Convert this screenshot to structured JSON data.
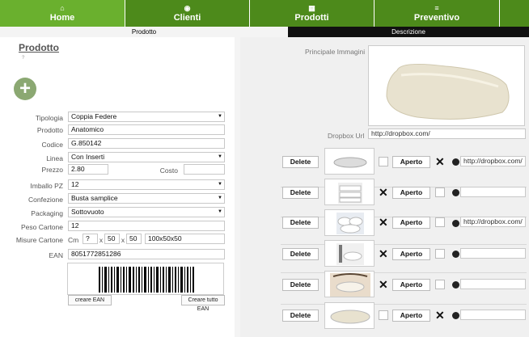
{
  "nav": {
    "home": "Home",
    "clienti": "Clienti",
    "prodotti": "Prodotti",
    "preventivo": "Preventivo"
  },
  "subtabs": {
    "prodotto": "Prodotto",
    "descrizione": "Descrizione"
  },
  "form": {
    "title": "Prodotto",
    "tiny": "?",
    "tipologia_label": "Tipologia",
    "tipologia_value": "Coppia Federe",
    "prodotto_label": "Prodotto",
    "prodotto_value": "Anatomico",
    "codice_label": "Codice",
    "codice_value": "G.850142",
    "linea_label": "Linea",
    "linea_value": "Con Inserti",
    "prezzo_label": "Prezzo",
    "prezzo_value": "2.80",
    "costo_label": "Costo",
    "costo_value": "",
    "imballo_label": "Imballo PZ",
    "imballo_value": "12",
    "confezione_label": "Confezione",
    "confezione_value": "Busta samplice",
    "packaging_label": "Packaging",
    "packaging_value": "Sottovuoto",
    "peso_label": "Peso Cartone",
    "peso_value": "12",
    "misure_label": "Misure Cartone",
    "misure_unit": "Cm",
    "misure_a": "?",
    "misure_b": "50",
    "misure_c": "50",
    "misure_sep1": "x",
    "misure_sep2": "x",
    "misure_total": "100x50x50",
    "ean_label": "EAN",
    "ean_value": "8051772851286",
    "crea_ean": "creare EAN",
    "crea_tutto": "Creare tutto EAN"
  },
  "images": {
    "principale_label": "Principale Immagini",
    "dropbox_label": "Dropbox Url",
    "dropbox_value": "http://dropbox.com/",
    "delete": "Delete",
    "aperto": "Aperto",
    "row1_url": "http://dropbox.com/",
    "row3_url": "http://dropbox.com/"
  }
}
